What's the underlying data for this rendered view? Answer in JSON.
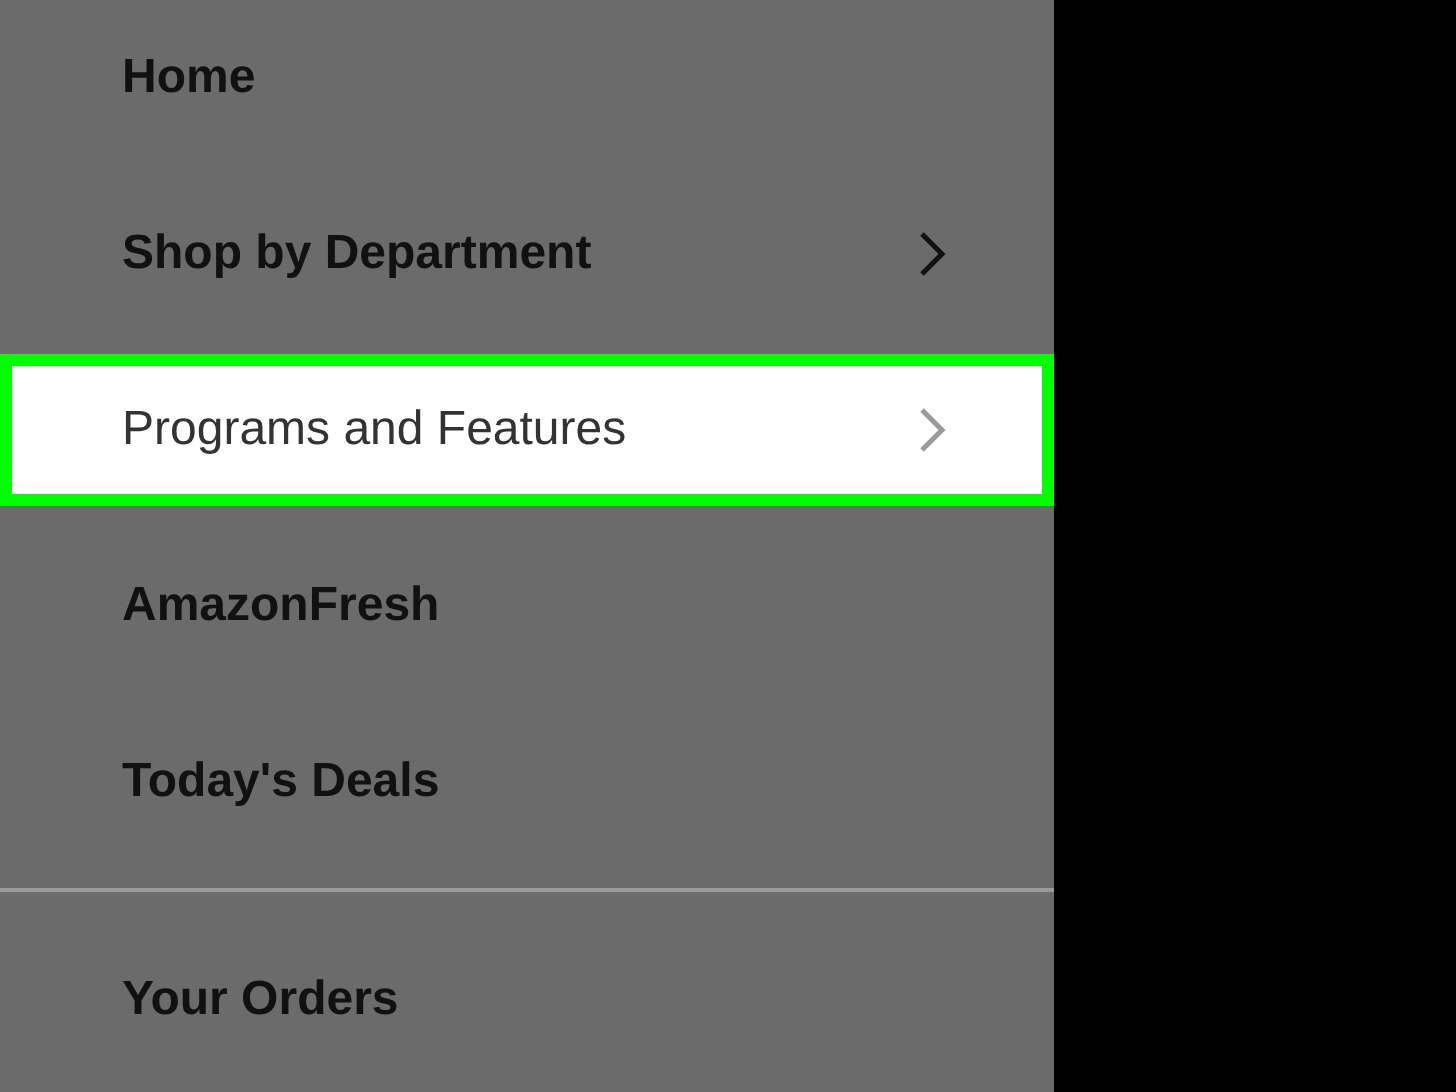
{
  "menu": {
    "groups": [
      {
        "items": [
          {
            "label": "Home",
            "chevron": false,
            "selected": false
          },
          {
            "label": "Shop by Department",
            "chevron": true,
            "selected": false
          },
          {
            "label": "Programs and Features",
            "chevron": true,
            "selected": true
          },
          {
            "label": "AmazonFresh",
            "chevron": false,
            "selected": false
          },
          {
            "label": "Today's Deals",
            "chevron": false,
            "selected": false
          }
        ]
      },
      {
        "items": [
          {
            "label": "Your Orders",
            "chevron": false,
            "selected": false
          }
        ]
      }
    ]
  }
}
